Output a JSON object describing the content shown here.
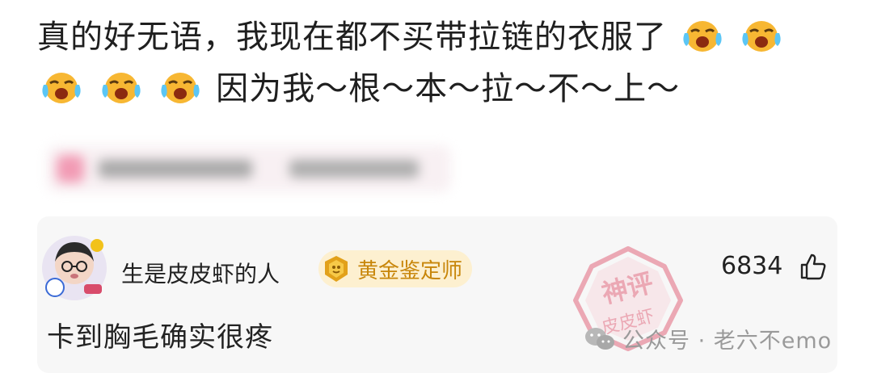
{
  "post": {
    "line1": "真的好无语，我现在都不买带拉链的衣服了",
    "line2": "因为我～根～本～拉～不～上～",
    "emoji_name": "crying-face-emoji"
  },
  "comment": {
    "username": "生是皮皮虾的人",
    "badge_label": "黄金鉴定师",
    "like_count": "6834",
    "text": "卡到胸毛确实很疼"
  },
  "stamp": {
    "top_text": "神评",
    "bottom_text": "皮皮虾"
  },
  "watermark": {
    "text": "公众号 · 老六不emo"
  },
  "colors": {
    "badge_bg": "#fdf0d0",
    "badge_text": "#c8860a",
    "stamp": "#e2687f",
    "card_bg": "#f7f7f7"
  }
}
